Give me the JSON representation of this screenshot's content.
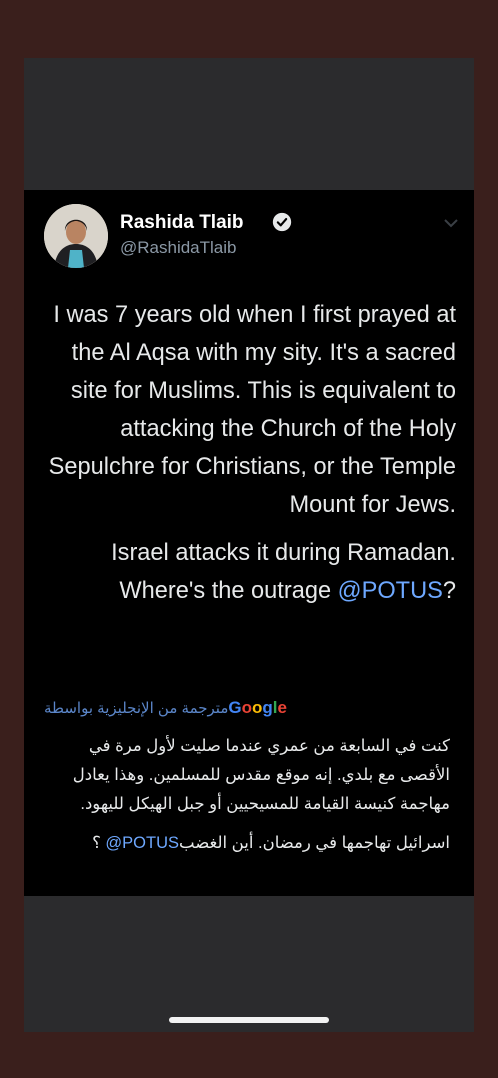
{
  "tweet": {
    "name": "Rashida Tlaib",
    "handle": "@RashidaTlaib",
    "text_p1": "I was 7 years old when I first prayed at the Al Aqsa with my sity. It's a sacred site for Muslims. This is equivalent to attacking the Church of the Holy Sepulchre for Christians, or the Temple Mount for Jews.",
    "text_p2_prefix": "Israel attacks it during Ramadan. Where's the outrage ",
    "text_p2_mention": "@POTUS",
    "text_p2_suffix": "?"
  },
  "translation": {
    "label_google": "Google",
    "label_rest": "مترجمة من الإنجليزية بواسطة",
    "p1": "كنت في السابعة من عمري عندما صليت لأول مرة في الأقصى مع بلدي. إنه موقع مقدس للمسلمين. وهذا يعادل مهاجمة كنيسة القيامة للمسيحيين أو جبل الهيكل لليهود.",
    "p2_prefix": "اسرائيل تهاجمها في رمضان. أين الغضب",
    "p2_mention": "@POTUS",
    "p2_suffix": " ؟"
  },
  "colors": {
    "background": "#3a1f1c",
    "tweet_bg": "#000000",
    "mention": "#6ea8ff",
    "verified": "#1d9bf0"
  }
}
